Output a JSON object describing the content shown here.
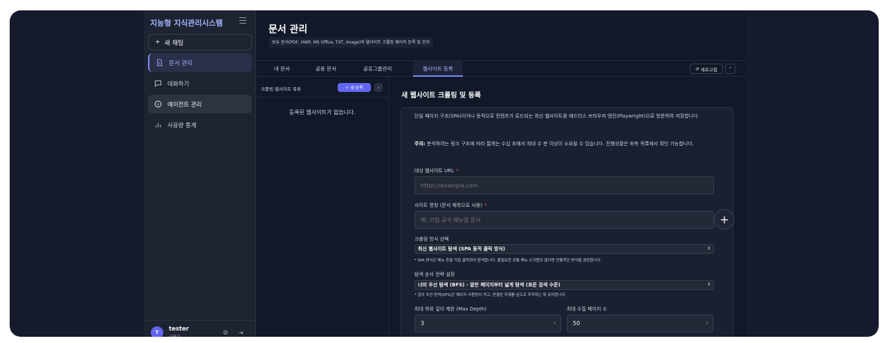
{
  "sidebar": {
    "brand": "지능형 지식관리시스템",
    "new_chat": "새 채팅",
    "items": [
      {
        "label": "문서 관리",
        "icon": "document-icon"
      },
      {
        "label": "대화하기",
        "icon": "chat-icon"
      },
      {
        "label": "에이전트 관리",
        "icon": "info-icon"
      },
      {
        "label": "사용량 통계",
        "icon": "bar-chart-icon"
      }
    ],
    "user": {
      "name": "tester",
      "role": "사용자",
      "avatar": "T"
    }
  },
  "header": {
    "title": "문서 관리",
    "subtitle": "보유 문서(PDF, HWP, MS Office, TXT, Image)와 웹사이트 크롤링 페이지 등록 및 관리"
  },
  "tabs": [
    "내 문서",
    "공용 문서",
    "공유그룹관리",
    "웹사이트 등록"
  ],
  "toolbar": {
    "refresh": "새로고침"
  },
  "sites_panel": {
    "title": "크롤링 웹사이트 목록",
    "add_button": "+ 새 등록",
    "empty": "등록된 웹사이트가 없습니다."
  },
  "form": {
    "title": "새 웹사이트 크롤링 및 등록",
    "desc": "단일 페이지 구조(SPA)이거나 동적으로 컨텐츠가 로드되는 최신 웹사이트를 헤드리스 브라우저 엔진(Playwright)으로 방문하여 저장합니다.",
    "note_label": "주의:",
    "note": "분석하려는 링크 구조에 따라 짧게는 수십 초에서 최대 수 분 이상이 소요될 수 있습니다. 진행상황은 좌측 목록에서 확인 가능합니다.",
    "url_label": "대상 웹사이트 URL",
    "url_placeholder": "https://example.com",
    "name_label": "사이트 명칭 (문서 제목으로 사용)",
    "name_placeholder": "예: 기업 공식 매뉴얼 문서",
    "method_label": "크롤링 방식 선택",
    "method_value": "최신 웹사이트 탐색 (SPA 동적 클릭 방식)",
    "method_hint": "* SPA 방식은 메뉴 등을 직접 클릭하여 탐색합니다. 불필요한 공통 메뉴 스크랩이 많다면 전통적인 방식을 권장합니다.",
    "strategy_label": "탐색 순서 전략 설정",
    "strategy_value": "너비 우선 탐색 (BFS) - 얕은 페이지부터 넓게 탐색 (표준 검색 수준)",
    "strategy_hint": "* 깊이 우선 탐색(DFS)은 메모리 사용량이 적고, 연결된 주제를 심도로 추적하는 데 유리합니다.",
    "depth_label": "최대 하위 깊이 제한 (Max Depth)",
    "depth_value": "3",
    "pages_label": "최대 수집 페이지 수",
    "pages_value": "50"
  }
}
